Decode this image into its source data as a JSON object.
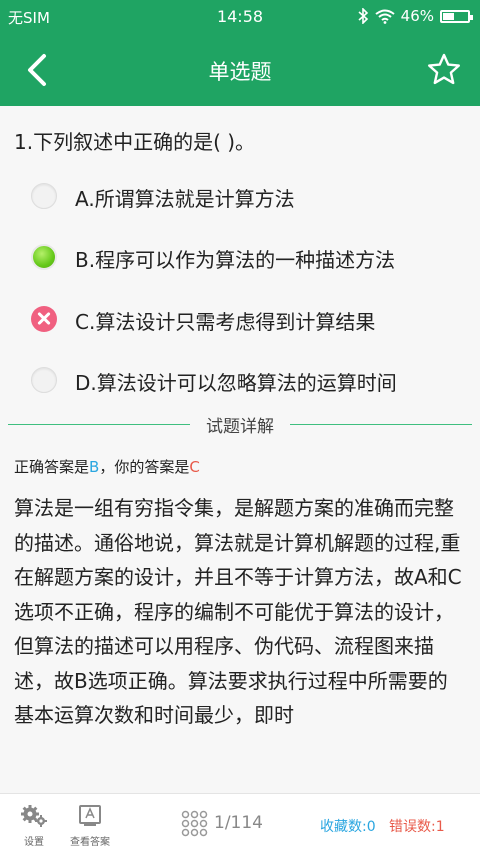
{
  "status_bar": {
    "carrier": "无SIM",
    "time": "14:58",
    "battery": "46%",
    "battery_level": 0.46
  },
  "nav": {
    "title": "单选题",
    "back_icon": "chevron-left-icon",
    "favorite_icon": "star-outline-icon"
  },
  "question": {
    "text": "1.下列叙述中正确的是( )。",
    "options": [
      {
        "label": "A.所谓算法就是计算方法",
        "state": "unselected"
      },
      {
        "label": "B.程序可以作为算法的一种描述方法",
        "state": "correct"
      },
      {
        "label": "C.算法设计只需考虑得到计算结果",
        "state": "wrong"
      },
      {
        "label": "D.算法设计可以忽略算法的运算时间",
        "state": "unselected"
      }
    ]
  },
  "explanation": {
    "heading": "试题详解",
    "correct_prefix": "正确答案是",
    "correct_answer": "B",
    "your_prefix": "，你的答案是",
    "your_answer": "C",
    "text": "算法是一组有穷指令集，是解题方案的准确而完整的描述。通俗地说，算法就是计算机解题的过程,重在解题方案的设计，并且不等于计算方法，故A和C选项不正确，程序的编制不可能优于算法的设计，但算法的描述可以用程序、伪代码、流程图来描述，故B选项正确。算法要求执行过程中所需要的基本运算次数和时间最少，即时"
  },
  "footer": {
    "settings_label": "设置",
    "view_answer_label": "查看答案",
    "page": "1/114",
    "favorites": "收藏数:0",
    "errors": "错误数:1"
  },
  "colors": {
    "primary": "#1fa463",
    "correct_answer": "#2aa6e0",
    "wrong_answer": "#e85a4a"
  }
}
